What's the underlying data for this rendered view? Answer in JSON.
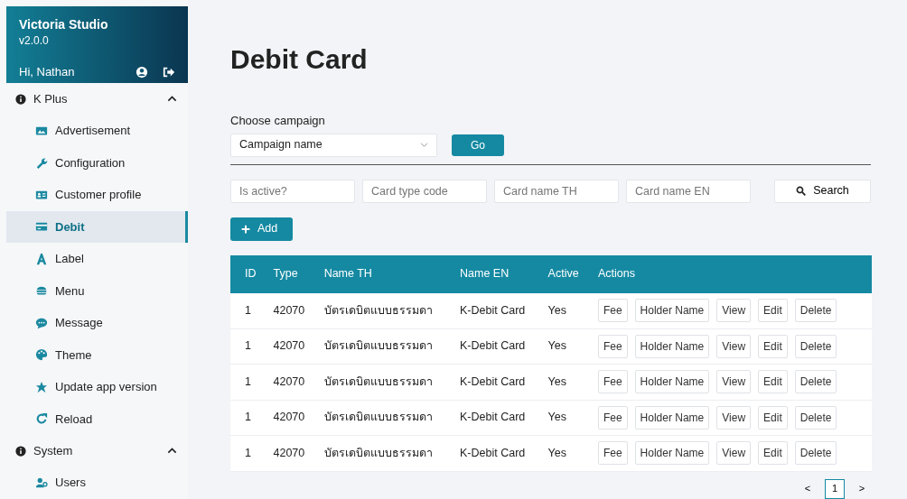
{
  "sidebar": {
    "app_name": "Victoria Studio",
    "version": "v2.0.0",
    "greeting": "Hi, Nathan",
    "groups": [
      {
        "label": "K Plus",
        "expanded": true,
        "children": [
          {
            "label": "Advertisement",
            "selected": false
          },
          {
            "label": "Configuration",
            "selected": false
          },
          {
            "label": "Customer profile",
            "selected": false
          },
          {
            "label": "Debit",
            "selected": true
          },
          {
            "label": "Label",
            "selected": false
          },
          {
            "label": "Menu",
            "selected": false
          },
          {
            "label": "Message",
            "selected": false
          },
          {
            "label": "Theme",
            "selected": false
          },
          {
            "label": "Update app version",
            "selected": false
          },
          {
            "label": "Reload",
            "selected": false
          }
        ]
      },
      {
        "label": "System",
        "expanded": true,
        "children": [
          {
            "label": "Users",
            "selected": false
          }
        ]
      }
    ]
  },
  "page_title": "Debit Card",
  "campaign": {
    "label": "Choose campaign",
    "placeholder": "Campaign name",
    "button": "Go"
  },
  "filters": [
    {
      "placeholder": "Is active?"
    },
    {
      "placeholder": "Card type code"
    },
    {
      "placeholder": "Card name TH"
    },
    {
      "placeholder": "Card name EN"
    }
  ],
  "search_button": "Search",
  "add_button": "Add",
  "table": {
    "columns": [
      "ID",
      "Type",
      "Name TH",
      "Name EN",
      "Active",
      "Actions"
    ],
    "rows": [
      {
        "id": "1",
        "type": "42070",
        "name_th": "บัตรเดบิตแบบธรรมดา",
        "name_en": "K-Debit Card",
        "active": "Yes",
        "actions": [
          "Fee",
          "Holder Name",
          "View",
          "Edit",
          "Delete"
        ]
      },
      {
        "id": "1",
        "type": "42070",
        "name_th": "บัตรเดบิตแบบธรรมดา",
        "name_en": "K-Debit Card",
        "active": "Yes",
        "actions": [
          "Fee",
          "Holder Name",
          "View",
          "Edit",
          "Delete"
        ]
      },
      {
        "id": "1",
        "type": "42070",
        "name_th": "บัตรเดบิตแบบธรรมดา",
        "name_en": "K-Debit Card",
        "active": "Yes",
        "actions": [
          "Fee",
          "Holder Name",
          "View",
          "Edit",
          "Delete"
        ]
      },
      {
        "id": "1",
        "type": "42070",
        "name_th": "บัตรเดบิตแบบธรรมดา",
        "name_en": "K-Debit Card",
        "active": "Yes",
        "actions": [
          "Fee",
          "Holder Name",
          "View",
          "Edit",
          "Delete"
        ]
      },
      {
        "id": "1",
        "type": "42070",
        "name_th": "บัตรเดบิตแบบธรรมดา",
        "name_en": "K-Debit Card",
        "active": "Yes",
        "actions": [
          "Fee",
          "Holder Name",
          "View",
          "Edit",
          "Delete"
        ]
      }
    ]
  },
  "pagination": {
    "prev": "<",
    "pages": [
      {
        "label": "1",
        "selected": true
      }
    ],
    "next": ">"
  }
}
